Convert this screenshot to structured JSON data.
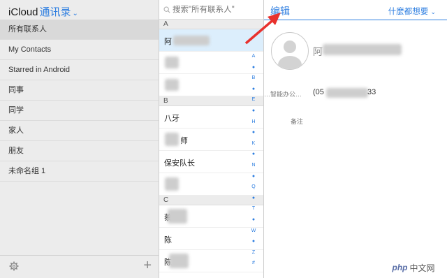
{
  "header": {
    "brand": "iCloud",
    "app_title": "通讯录",
    "subtitle": ""
  },
  "groups": [
    "所有联系人",
    "My Contacts",
    "Starred in Android",
    "同事",
    "同学",
    "家人",
    "朋友",
    "未命名组 1"
  ],
  "selected_group": "所有联系人",
  "search": {
    "placeholder": "搜索\"所有联系人\""
  },
  "sections": {
    "A": {
      "label": "A",
      "rows": [
        "阿",
        "",
        ""
      ]
    },
    "B": {
      "label": "B",
      "rows": [
        "八牙",
        "师",
        "保安队长",
        ""
      ]
    },
    "C": {
      "label": "C",
      "rows": [
        "蔡",
        "陈",
        "陈"
      ]
    }
  },
  "alphabet": [
    "A",
    "●",
    "B",
    "●",
    "E",
    "●",
    "H",
    "●",
    "K",
    "●",
    "N",
    "●",
    "Q",
    "●",
    "T",
    "●",
    "W",
    "●",
    "Z",
    "#"
  ],
  "detail": {
    "edit_label": "编辑",
    "menu_label": "什麼都想要",
    "name_partial": "阿",
    "company_label": "…智能办公…",
    "phone_prefix": "(05",
    "phone_suffix": "33",
    "note_label": "备注"
  },
  "watermark": {
    "logo": "php",
    "text": "中文网"
  },
  "colors": {
    "accent": "#2d7ee0",
    "arrow": "#e8312d",
    "sidebar_bg": "#ececec",
    "selected_row": "#dceefc"
  },
  "icons": {
    "settings": "gear-icon",
    "add": "plus-icon",
    "search": "search-icon",
    "avatar": "person-silhouette-icon"
  }
}
